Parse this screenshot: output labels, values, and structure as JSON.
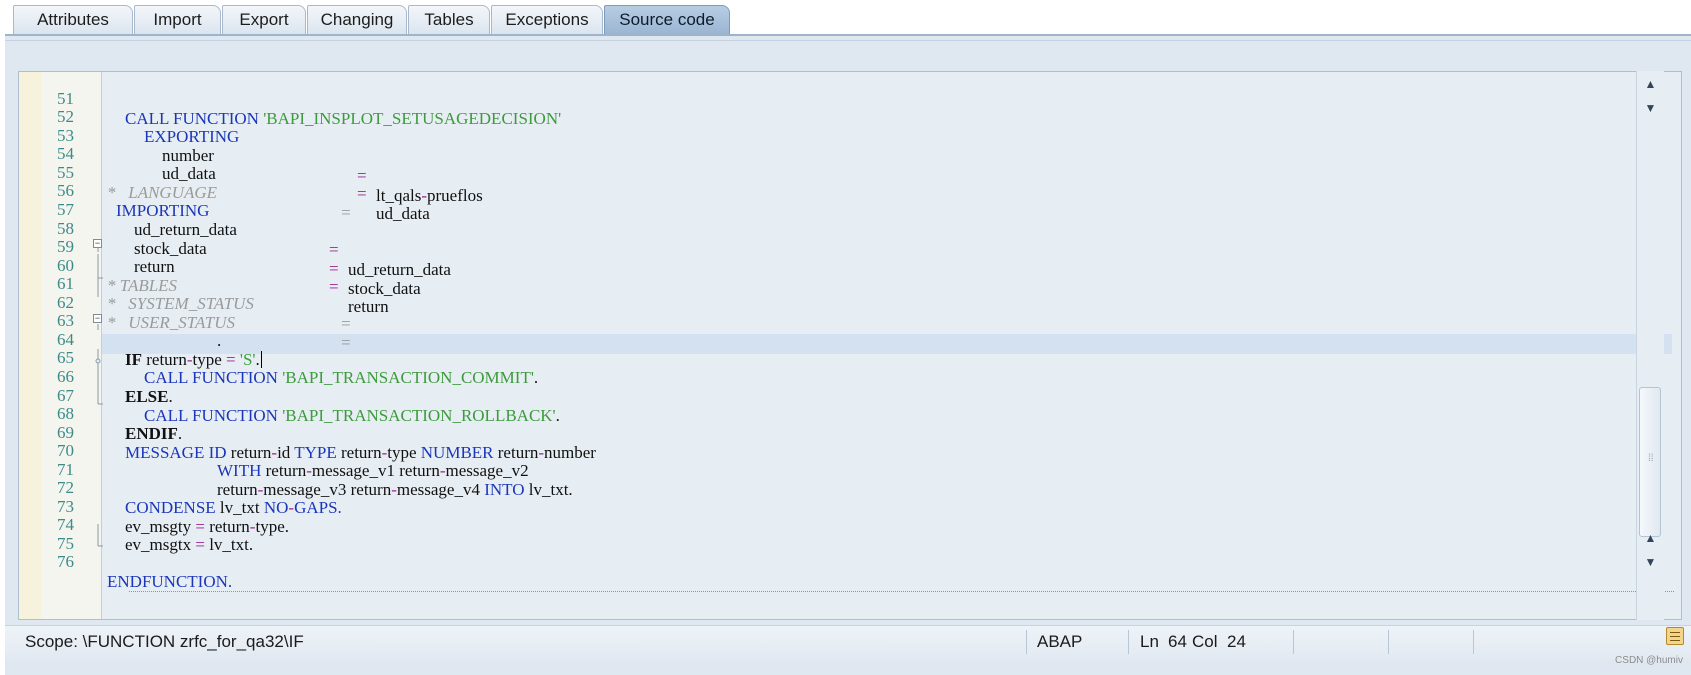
{
  "tabs": [
    {
      "label": "Attributes"
    },
    {
      "label": "Import"
    },
    {
      "label": "Export"
    },
    {
      "label": "Changing"
    },
    {
      "label": "Tables"
    },
    {
      "label": "Exceptions"
    },
    {
      "label": "Source code",
      "active": true
    }
  ],
  "editor": {
    "line_numbers": [
      "51",
      "52",
      "53",
      "54",
      "55",
      "56",
      "57",
      "58",
      "59",
      "60",
      "61",
      "62",
      "63",
      "64",
      "65",
      "66",
      "67",
      "68",
      "69",
      "70",
      "71",
      "72",
      "73",
      "74",
      "75",
      "76"
    ],
    "lines": {
      "l51": {
        "a": "CALL FUNCTION ",
        "b": "'BAPI_INSPLOT_SETUSAGEDECISION'"
      },
      "l52": {
        "a": "EXPORTING"
      },
      "l53": {
        "a": "number",
        "op": "=",
        "b": "lt_qals",
        "c": "prueflos"
      },
      "l54": {
        "a": "ud_data",
        "op": "=",
        "b": "ud_data"
      },
      "l55": {
        "a": "*   LANGUAGE",
        "b": "="
      },
      "l56": {
        "a": "IMPORTING"
      },
      "l57": {
        "a": "ud_return_data",
        "op": "=",
        "b": "ud_return_data"
      },
      "l58": {
        "a": "stock_data",
        "op": "=",
        "b": "stock_data"
      },
      "l59": {
        "a": "return",
        "op": "=",
        "b": "return"
      },
      "l60": {
        "a": "* TABLES"
      },
      "l61": {
        "a": "*   SYSTEM_STATUS",
        "b": "="
      },
      "l62": {
        "a": "*   USER_STATUS",
        "b": "="
      },
      "l63": {
        "a": "."
      },
      "l64": {
        "a": "IF",
        "b": "return",
        "c": "type",
        "op": "=",
        "s": "'S'",
        "d": "."
      },
      "l65": {
        "a": "CALL FUNCTION ",
        "b": "'BAPI_TRANSACTION_COMMIT'",
        "c": "."
      },
      "l66": {
        "a": "ELSE",
        "b": "."
      },
      "l67": {
        "a": "CALL FUNCTION ",
        "b": "'BAPI_TRANSACTION_ROLLBACK'",
        "c": "."
      },
      "l68": {
        "a": "ENDIF",
        "b": "."
      },
      "l69": {
        "k1": "MESSAGE ID",
        "a": " return",
        "b": "id ",
        "k2": "TYPE",
        "c": " return",
        "d": "type ",
        "k3": "NUMBER",
        "e": " return",
        "f": "number"
      },
      "l70": {
        "k1": "WITH",
        "a": " return",
        "b": "message_v1 return",
        "c": "message_v2"
      },
      "l71": {
        "a": "return",
        "b": "message_v3 return",
        "c": "message_v4 ",
        "k1": "INTO",
        "d": " lv_txt."
      },
      "l72": {
        "k1": "CONDENSE",
        "a": " lv_txt ",
        "k2": "NO",
        "b": "GAPS."
      },
      "l73": {
        "a": "ev_msgty ",
        "op": "=",
        "b": " return",
        "c": "type."
      },
      "l74": {
        "a": "ev_msgtx ",
        "op": "=",
        "b": " lv_txt."
      },
      "l75": {},
      "l76": {
        "a": "ENDFUNCTION."
      }
    }
  },
  "status_bar": {
    "scope": "Scope: \\FUNCTION zrfc_for_qa32\\IF",
    "language": "ABAP",
    "ln_label": "Ln",
    "ln_value": "64",
    "col_label": "Col",
    "col_value": "24"
  },
  "watermark": "CSDN @humiv",
  "icons": [
    "scroll-up-icon",
    "scroll-down-icon",
    "collapse-icon",
    "notes-icon"
  ]
}
